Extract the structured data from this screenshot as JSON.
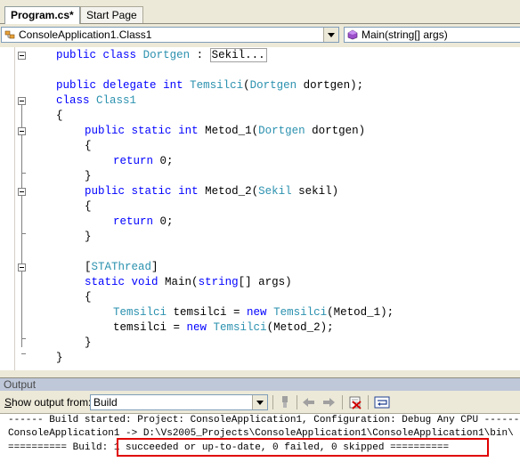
{
  "tabs": [
    {
      "label": "Program.cs*"
    },
    {
      "label": "Start Page"
    }
  ],
  "type_combo": {
    "value": "ConsoleApplication1.Class1"
  },
  "member_combo": {
    "value": "Main(string[] args)"
  },
  "code": {
    "line1": {
      "kw1": "public",
      "kw2": "class",
      "type": "Dortgen",
      "sep": " : ",
      "collapsed": "Sekil..."
    },
    "line3": {
      "kw1": "public",
      "kw2": "delegate",
      "kw3": "int",
      "type": "Temsilci",
      "p1": "(",
      "ptype": "Dortgen",
      "p2": " dortgen);"
    },
    "line4": {
      "kw1": "class",
      "type": "Class1"
    },
    "line5": "{",
    "line6": {
      "kw1": "public",
      "kw2": "static",
      "kw3": "int",
      "name": " Metod_1(",
      "ptype": "Dortgen",
      "rest": " dortgen)"
    },
    "line7": "{",
    "line8": {
      "kw": "return",
      "rest": " 0;"
    },
    "line9": "}",
    "line10": {
      "kw1": "public",
      "kw2": "static",
      "kw3": "int",
      "name": " Metod_2(",
      "ptype": "Sekil",
      "rest": " sekil)"
    },
    "line11": "{",
    "line12": {
      "kw": "return",
      "rest": " 0;"
    },
    "line13": "}",
    "line15": {
      "p1": "[",
      "attr": "STAThread",
      "p2": "]"
    },
    "line16": {
      "kw1": "static",
      "kw2": "void",
      "name": " Main(",
      "kw3": "string",
      "rest": "[] args)"
    },
    "line17": "{",
    "line18": {
      "type1": "Temsilci",
      "mid": " temsilci = ",
      "kw": "new",
      "type2": "Temsilci",
      "rest": "(Metod_1);"
    },
    "line19": {
      "pre": "temsilci = ",
      "kw": "new",
      "type": "Temsilci",
      "rest": "(Metod_2);"
    },
    "line20": "}",
    "line21": "}"
  },
  "output": {
    "title": "Output",
    "show_from_label_s": "S",
    "show_from_label_rest": "how output from:",
    "source": "Build",
    "lines": [
      "------ Build started: Project: ConsoleApplication1, Configuration: Debug Any CPU ------",
      "ConsoleApplication1 -> D:\\Vs2005_Projects\\ConsoleApplication1\\ConsoleApplication1\\bin\\",
      "========== Build: 1 succeeded or up-to-date, 0 failed, 0 skipped =========="
    ]
  },
  "icons": [
    "class-icon",
    "method-icon",
    "find-message-icon",
    "prev-message-icon",
    "next-message-icon",
    "clear-all-icon",
    "word-wrap-icon"
  ],
  "colors": {
    "keyword": "#0000ff",
    "type": "#2b91af",
    "highlight": "#e00000"
  }
}
